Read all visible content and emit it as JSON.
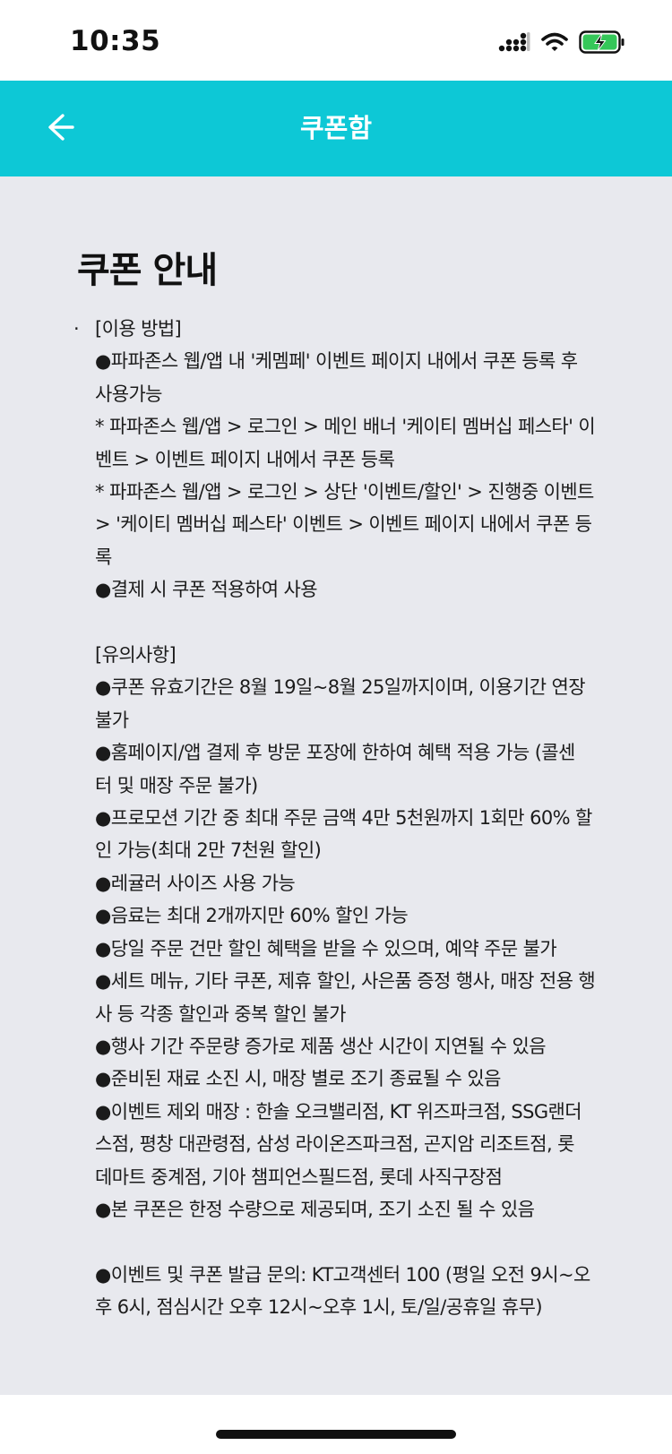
{
  "status_bar": {
    "time": "10:35"
  },
  "header": {
    "title": "쿠폰함"
  },
  "content": {
    "title": "쿠폰 안내",
    "bullet": "·",
    "lines": [
      "[이용 방법]",
      "●파파존스 웹/앱 내 '케멤페' 이벤트 페이지 내에서 쿠폰 등록 후",
      "사용가능",
      "* 파파존스 웹/앱 > 로그인 > 메인 배너 '케이티 멤버십 페스타' 이",
      "벤트 > 이벤트 페이지 내에서 쿠폰 등록",
      "* 파파존스 웹/앱 > 로그인 > 상단 '이벤트/할인' > 진행중 이벤트",
      "> '케이티 멤버십 페스타' 이벤트 > 이벤트 페이지 내에서 쿠폰 등",
      "록",
      "●결제 시 쿠폰 적용하여 사용",
      "",
      "[유의사항]",
      "●쿠폰 유효기간은 8월 19일~8월 25일까지이며, 이용기간 연장",
      "불가",
      "●홈페이지/앱 결제 후 방문 포장에 한하여 혜택 적용 가능 (콜센",
      "터 및 매장 주문 불가)",
      "●프로모션 기간 중 최대 주문 금액 4만 5천원까지 1회만 60% 할",
      "인 가능(최대 2만 7천원 할인)",
      "●레귤러 사이즈 사용 가능",
      "●음료는 최대 2개까지만 60% 할인 가능",
      "●당일 주문 건만 할인 혜택을 받을 수 있으며, 예약 주문 불가",
      "●세트 메뉴, 기타 쿠폰, 제휴 할인, 사은품 증정 행사, 매장 전용 행",
      "사 등 각종 할인과 중복 할인 불가",
      "●행사 기간 주문량 증가로 제품 생산 시간이 지연될 수 있음",
      "●준비된 재료 소진 시, 매장 별로 조기 종료될 수 있음",
      "●이벤트 제외 매장 : 한솔 오크밸리점, KT 위즈파크점, SSG랜더",
      "스점, 평창 대관령점, 삼성 라이온즈파크점, 곤지암 리조트점, 롯",
      "데마트 중계점, 기아 챔피언스필드점, 롯데 사직구장점",
      "●본 쿠폰은 한정 수량으로 제공되며, 조기 소진 될 수 있음",
      "",
      "●이벤트 및 쿠폰 발급 문의: KT고객센터 100 (평일 오전 9시~오",
      "후 6시, 점심시간 오후 12시~오후 1시, 토/일/공휴일 휴무)"
    ]
  },
  "colors": {
    "header_bg": "#0dc8d6",
    "content_bg": "#e8e9ee",
    "battery_fill": "#35c759"
  },
  "icons": {
    "back": "arrow-left-icon",
    "signal": "signal-icon",
    "wifi": "wifi-icon",
    "battery": "battery-charging-icon"
  }
}
